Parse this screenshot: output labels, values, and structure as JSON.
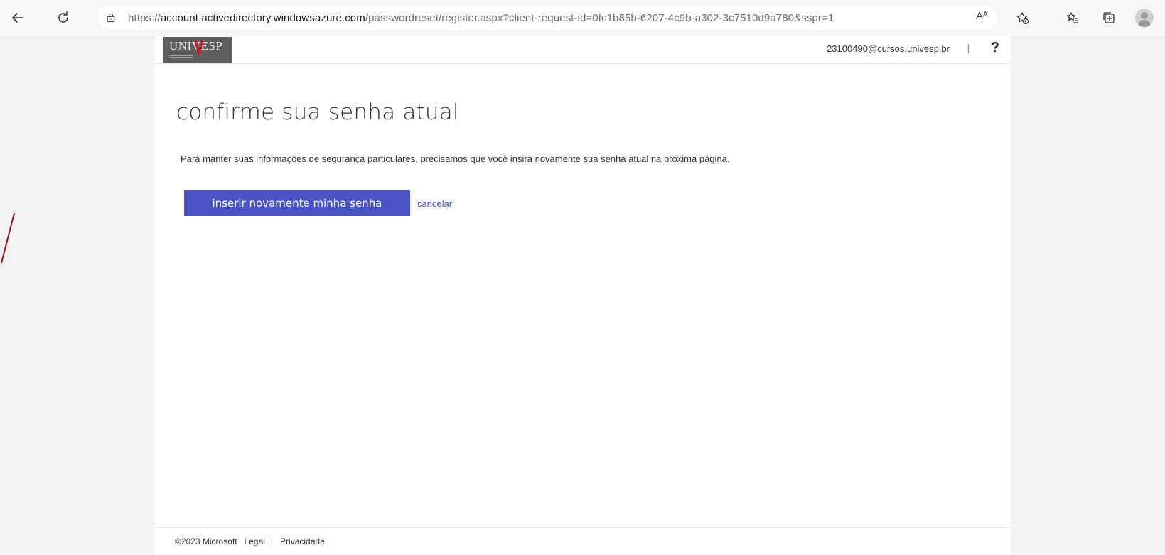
{
  "browser": {
    "url_prefix": "https://",
    "url_domain": "account.activedirectory.windowsazure.com",
    "url_path": "/passwordreset/register.aspx?client-request-id=0fc1b85b-6207-4c9b-a302-3c7510d9a780&sspr=1",
    "read_aloud": "Aᴬ"
  },
  "header": {
    "logo_text": "UNIVESP",
    "user_email": "23100490@cursos.univesp.br",
    "separator": "|",
    "help_label": "?"
  },
  "main": {
    "title": "confirme sua senha atual",
    "description": "Para manter suas informações de segurança particulares, precisamos que você insira novamente sua senha atual na próxima página.",
    "primary_button": "inserir novamente minha senha",
    "cancel_link": "cancelar"
  },
  "footer": {
    "copyright": "©2023 Microsoft",
    "legal": "Legal",
    "separator": "|",
    "privacy": "Privacidade"
  },
  "colors": {
    "accent": "#4a53c6",
    "background": "#f2f2f2"
  }
}
